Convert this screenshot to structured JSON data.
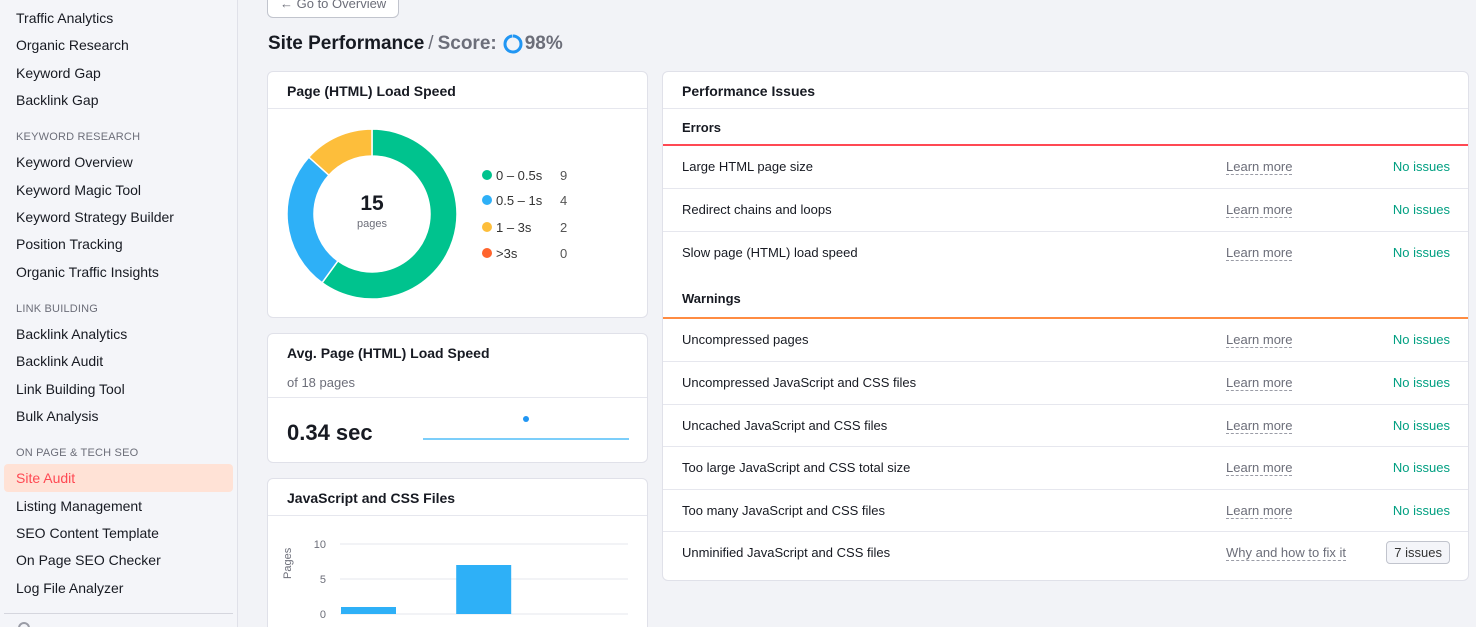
{
  "sidebar": {
    "groups": [
      {
        "title": "",
        "items": [
          "Traffic Analytics",
          "Organic Research",
          "Keyword Gap",
          "Backlink Gap"
        ]
      },
      {
        "title": "KEYWORD RESEARCH",
        "items": [
          "Keyword Overview",
          "Keyword Magic Tool",
          "Keyword Strategy Builder",
          "Position Tracking",
          "Organic Traffic Insights"
        ]
      },
      {
        "title": "LINK BUILDING",
        "items": [
          "Backlink Analytics",
          "Backlink Audit",
          "Link Building Tool",
          "Bulk Analysis"
        ]
      },
      {
        "title": "ON PAGE & TECH SEO",
        "items": [
          "Site Audit",
          "Listing Management",
          "SEO Content Template",
          "On Page SEO Checker",
          "Log File Analyzer"
        ]
      }
    ],
    "active_item": "Site Audit"
  },
  "header": {
    "back_button": "← Go to Overview",
    "title": "Site Performance",
    "score_label": "Score:",
    "score_value": "98%",
    "score_fraction": 0.98
  },
  "load_speed": {
    "title": "Page (HTML) Load Speed",
    "total": "15",
    "total_label": "pages",
    "buckets": [
      {
        "label": "0 – 0.5s",
        "count": "9",
        "value": 9,
        "color": "#00c38e"
      },
      {
        "label": "0.5 – 1s",
        "count": "4",
        "value": 4,
        "color": "#2eb0f7"
      },
      {
        "label": "1 – 3s",
        "count": "2",
        "value": 2,
        "color": "#fdbe3b"
      },
      {
        "label": ">3s",
        "count": "0",
        "value": 0,
        "color": "#ff642d"
      }
    ]
  },
  "avg_speed": {
    "title": "Avg. Page (HTML) Load Speed",
    "subtitle": "of 18 pages",
    "value": "0.34 sec"
  },
  "js_css": {
    "title": "JavaScript and CSS Files",
    "ylabel": "Pages",
    "y_ticks": [
      "10",
      "5",
      "0"
    ],
    "bar_color": "#2eb0f7"
  },
  "chart_data": {
    "type": "bar",
    "categories": [
      "",
      "",
      "",
      "",
      ""
    ],
    "values": [
      1,
      0,
      7,
      0,
      0
    ],
    "ylabel": "Pages",
    "ylim": [
      0,
      10
    ]
  },
  "issues": {
    "title": "Performance Issues",
    "errors_title": "Errors",
    "warnings_title": "Warnings",
    "errors_color": "#ff4953",
    "warnings_color": "#ff8c42",
    "errors": [
      {
        "label": "Large HTML page size",
        "link": "Learn more",
        "status": "No issues"
      },
      {
        "label": "Redirect chains and loops",
        "link": "Learn more",
        "status": "No issues"
      },
      {
        "label": "Slow page (HTML) load speed",
        "link": "Learn more",
        "status": "No issues"
      }
    ],
    "warnings": [
      {
        "label": "Uncompressed pages",
        "link": "Learn more",
        "status": "No issues"
      },
      {
        "label": "Uncompressed JavaScript and CSS files",
        "link": "Learn more",
        "status": "No issues"
      },
      {
        "label": "Uncached JavaScript and CSS files",
        "link": "Learn more",
        "status": "No issues"
      },
      {
        "label": "Too large JavaScript and CSS total size",
        "link": "Learn more",
        "status": "No issues"
      },
      {
        "label": "Too many JavaScript and CSS files",
        "link": "Learn more",
        "status": "No issues"
      },
      {
        "label": "Unminified JavaScript and CSS files",
        "link": "Why and how to fix it",
        "status": "7 issues"
      }
    ]
  }
}
